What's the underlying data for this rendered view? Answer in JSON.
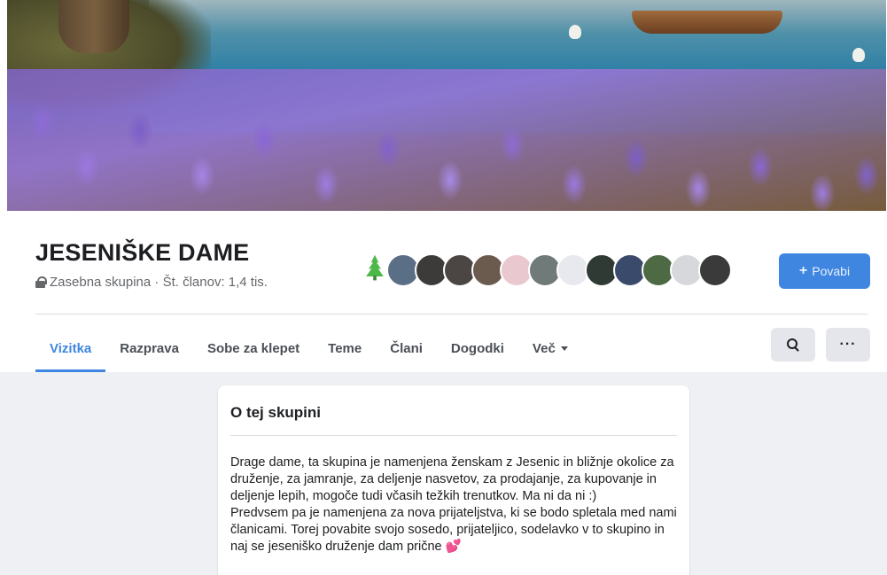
{
  "group": {
    "title": "JESENIŠKE DAME",
    "meta": "Zasebna skupina · Št. članov: 1,4 tis."
  },
  "invite_button": {
    "label": "Povabi",
    "icon": "plus-icon"
  },
  "tabs": [
    {
      "label": "Vizitka",
      "active": true
    },
    {
      "label": "Razprava"
    },
    {
      "label": "Sobe za klepet"
    },
    {
      "label": "Teme"
    },
    {
      "label": "Člani"
    },
    {
      "label": "Dogodki"
    },
    {
      "label": "Več",
      "icon": "caret-down-icon"
    }
  ],
  "toolbar": {
    "search_icon": "search-icon",
    "more_label": "···"
  },
  "members": {
    "avatar_colors": [
      "#5a6e86",
      "#3d3b3a",
      "#4b4544",
      "#6b5b4f",
      "#e9c8cf",
      "#707a78",
      "#e7e9ee",
      "#2f3a34",
      "#3a4a6a",
      "#4d6a45",
      "#d6d8dc",
      "#3a3a3a"
    ],
    "first_icon": "tree-icon"
  },
  "about": {
    "title": "O tej skupini",
    "paragraphs": [
      "Drage dame, ta skupina je namenjena ženskam z Jesenic in bližnje okolice za druženje, za jamranje, za deljenje nasvetov, za prodajanje, za kupovanje in deljenje lepih, mogoče tudi včasih težkih trenutkov. Ma ni da ni :)",
      "Predvsem pa je namenjena za nova prijateljstva, ki se bodo spletala med nami članicami. Torej povabite svojo sosedo, prijateljico, sodelavko v to skupino in naj se jeseniško druženje dam prične"
    ],
    "heart": "💕"
  },
  "colors": {
    "accent": "#3f86e0",
    "page_bg": "#eef0f3"
  }
}
